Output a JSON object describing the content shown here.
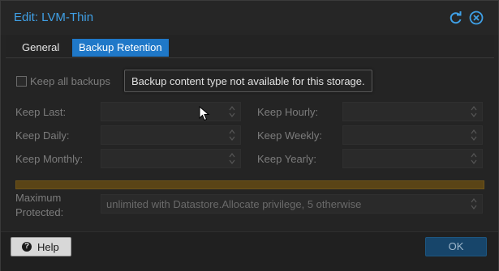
{
  "window": {
    "title": "Edit: LVM-Thin"
  },
  "title_icons": [
    "reset-icon",
    "close-icon"
  ],
  "tabs": [
    {
      "label": "General",
      "active": false
    },
    {
      "label": "Backup Retention",
      "active": true
    }
  ],
  "keep_all": {
    "label": "Keep all backups",
    "checked": false
  },
  "tooltip": "Backup content type not available for this storage.",
  "fields": {
    "keep_last": {
      "label": "Keep Last:",
      "value": ""
    },
    "keep_hourly": {
      "label": "Keep Hourly:",
      "value": ""
    },
    "keep_daily": {
      "label": "Keep Daily:",
      "value": ""
    },
    "keep_weekly": {
      "label": "Keep Weekly:",
      "value": ""
    },
    "keep_monthly": {
      "label": "Keep Monthly:",
      "value": ""
    },
    "keep_yearly": {
      "label": "Keep Yearly:",
      "value": ""
    }
  },
  "max_protected": {
    "label_line1": "Maximum",
    "label_line2": "Protected:",
    "placeholder": "unlimited with Datastore.Allocate privilege, 5 otherwise"
  },
  "buttons": {
    "help": "Help",
    "ok": "OK"
  },
  "colors": {
    "accent": "#3fa0e6",
    "active_tab": "#1f78c8",
    "warning_bar": "#5a4416",
    "ok_button": "#17456a"
  }
}
